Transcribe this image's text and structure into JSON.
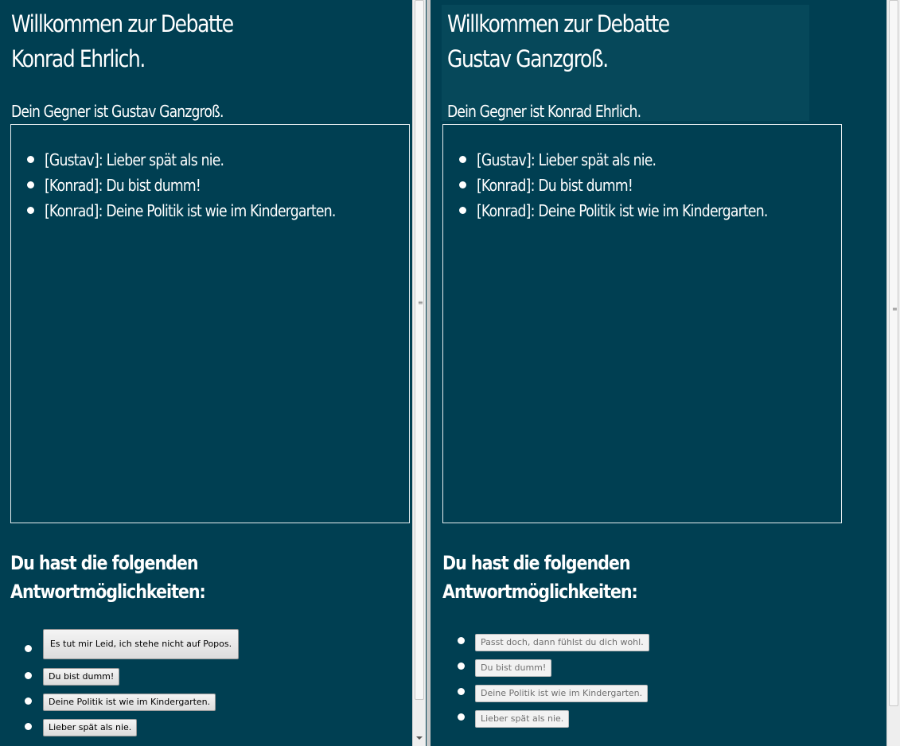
{
  "left": {
    "welcome_line1": "Willkommen zur Debatte",
    "welcome_line2": "Konrad Ehrlich.",
    "opponent": "Dein Gegner ist Gustav Ganzgroß.",
    "chat": [
      "[Gustav]: Lieber spät als nie.",
      "[Konrad]: Du bist dumm!",
      "[Konrad]: Deine Politik ist wie im Kindergarten."
    ],
    "options_heading_line1": "Du hast die folgenden",
    "options_heading_line2": "Antwortmöglichkeiten:",
    "options": [
      "Es tut mir Leid, ich stehe nicht auf Popos.",
      "Du bist dumm!",
      "Deine Politik ist wie im Kindergarten.",
      "Lieber spät als nie."
    ]
  },
  "right": {
    "welcome_line1": "Willkommen zur Debatte",
    "welcome_line2": "Gustav Ganzgroß.",
    "opponent": "Dein Gegner ist Konrad Ehrlich.",
    "chat": [
      "[Gustav]: Lieber spät als nie.",
      "[Konrad]: Du bist dumm!",
      "[Konrad]: Deine Politik ist wie im Kindergarten."
    ],
    "options_heading_line1": "Du hast die folgenden",
    "options_heading_line2": "Antwortmöglichkeiten:",
    "options": [
      "Passt doch, dann fühlst du dich wohl.",
      "Du bist dumm!",
      "Deine Politik ist wie im Kindergarten.",
      "Lieber spät als nie."
    ]
  },
  "colors": {
    "background": "#003f52",
    "text": "#ffffff",
    "disabled_button_text": "#707070"
  }
}
